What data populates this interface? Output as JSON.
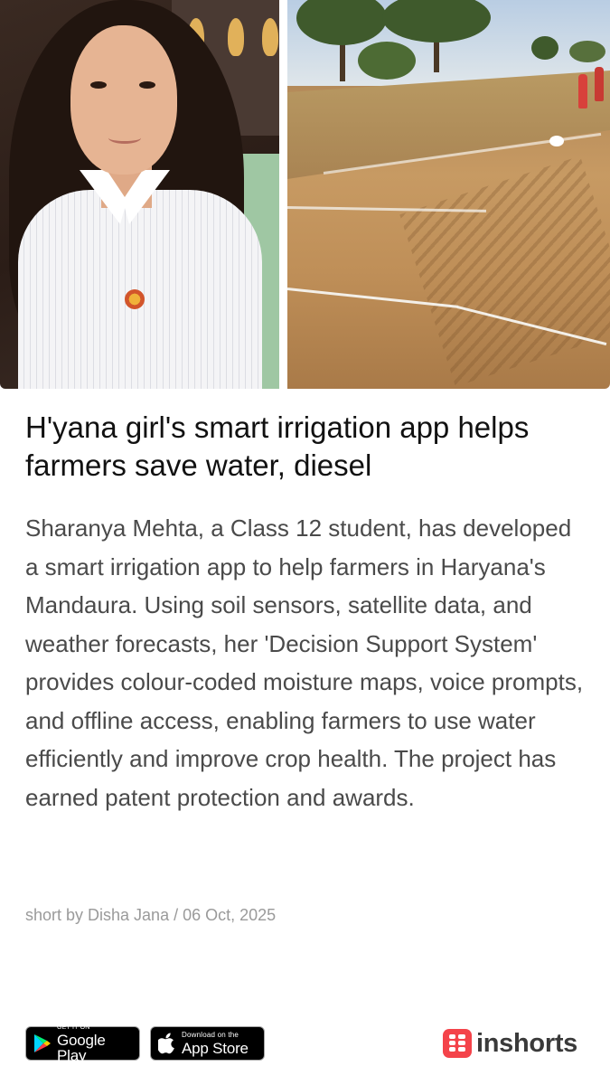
{
  "images": {
    "left_photo": "Portrait of Sharanya Mehta",
    "right_photo": "Farm field with marked irrigation channels"
  },
  "article": {
    "headline": "H'yana girl's smart irrigation app helps farmers save water, diesel",
    "body": "Sharanya Mehta, a Class 12 student, has developed a smart irrigation app to help farmers in Haryana's Mandaura. Using soil sensors, satellite data, and weather forecasts, her 'Decision Support System' provides colour-coded moisture maps, voice prompts, and offline access, enabling farmers to use water efficiently and improve crop health. The project has earned patent protection and awards.",
    "byline": "short by Disha Jana / 06 Oct, 2025"
  },
  "footer": {
    "google_play": {
      "small": "GET IT ON",
      "big": "Google Play"
    },
    "app_store": {
      "small": "Download on the",
      "big": "App Store"
    },
    "brand": {
      "name": "inshorts",
      "color": "#f4434a"
    }
  },
  "icons": {
    "google_play": "google-play-icon",
    "app_store": "apple-icon",
    "brand": "inshorts-logo-icon"
  }
}
